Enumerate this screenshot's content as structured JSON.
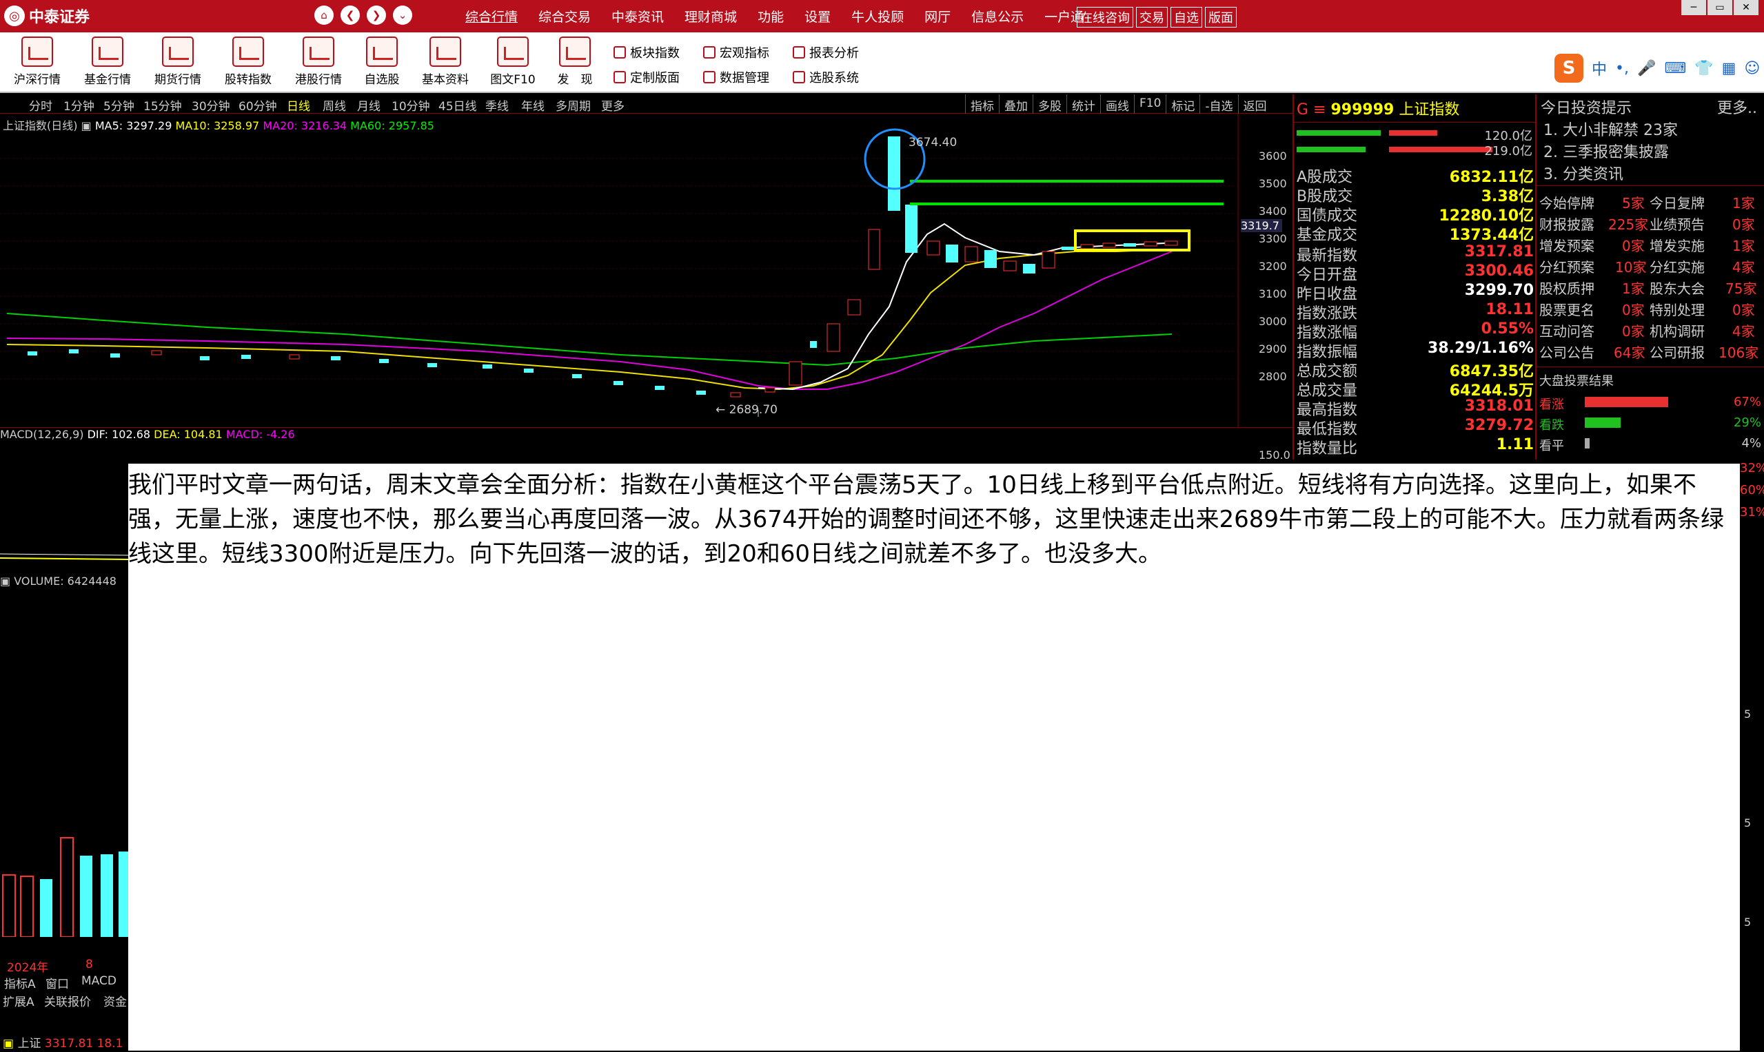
{
  "app": {
    "brand": "中泰证券",
    "top_menu": [
      "综合行情",
      "综合交易",
      "中泰资讯",
      "理财商城",
      "功能",
      "设置",
      "牛人投顾",
      "网厅",
      "信息公示",
      "一户通"
    ],
    "quick_buttons": [
      "在线咨询",
      "交易",
      "自选",
      "版面"
    ]
  },
  "toolbar": {
    "big_buttons": [
      "沪深行情",
      "基金行情",
      "期货行情",
      "股转指数",
      "港股行情",
      "自选股",
      "基本资料",
      "图文F10",
      "发　现"
    ],
    "small_buttons": [
      "板块指数",
      "宏观指标",
      "报表分析",
      "定制版面",
      "数据管理",
      "选股系统"
    ],
    "ime": [
      "中",
      "•,"
    ]
  },
  "period_bar": {
    "items": [
      "分时",
      "1分钟",
      "5分钟",
      "15分钟",
      "30分钟",
      "60分钟",
      "日线",
      "周线",
      "月线",
      "10分钟",
      "45日线",
      "季线",
      "年线",
      "多周期",
      "更多"
    ],
    "selected": "日线",
    "tools": [
      "指标",
      "叠加",
      "多股",
      "统计",
      "画线",
      "F10",
      "标记",
      "-自选",
      "返回"
    ]
  },
  "chart_header": {
    "title": "上证指数(日线)",
    "ma5": "MA5: 3297.29",
    "ma10": "MA10: 3258.97",
    "ma20": "MA20: 3216.34",
    "ma60": "MA60: 2957.85",
    "high_label": "3674.40",
    "low_label": "2689.70",
    "last_price_tag": "3319.7",
    "y_ticks": [
      "3600",
      "3500",
      "3400",
      "3300",
      "3200",
      "3100",
      "3000",
      "2900",
      "2800"
    ],
    "macd": "MACD(12,26,9)",
    "dif": "DIF: 102.68",
    "dea": "DEA: 104.81",
    "macd_val": "MACD: -4.26",
    "macd_tick": "150.0",
    "volume": "VOLUME: 6424448",
    "x_labels": [
      "2024年",
      "8"
    ],
    "colors": {
      "up": "#ff3232",
      "down": "#54ffff",
      "ma5": "#ffffff",
      "ma10": "#ffff00",
      "ma20": "#ff00ff",
      "ma60": "#00e000",
      "highlight_circle": "#1e90ff",
      "highlight_box": "#ffff00"
    }
  },
  "quote_panel": {
    "code": "999999",
    "name": "上证指数",
    "prefix": "G ≡",
    "bar_values": [
      "120.0亿",
      "219.0亿"
    ],
    "rows": [
      {
        "k": "A股成交",
        "v": "6832.11亿"
      },
      {
        "k": "B股成交",
        "v": "3.38亿"
      },
      {
        "k": "国债成交",
        "v": "12280.10亿"
      },
      {
        "k": "基金成交",
        "v": "1373.44亿"
      },
      {
        "k": "最新指数",
        "v": "3317.81"
      },
      {
        "k": "今日开盘",
        "v": "3300.46"
      },
      {
        "k": "昨日收盘",
        "v": "3299.70"
      },
      {
        "k": "指数涨跌",
        "v": "18.11"
      },
      {
        "k": "指数涨幅",
        "v": "0.55%"
      },
      {
        "k": "指数振幅",
        "v": "38.29/1.16%"
      },
      {
        "k": "总成交额",
        "v": "6847.35亿"
      },
      {
        "k": "总成交量",
        "v": "64244.5万"
      },
      {
        "k": "最高指数",
        "v": "3318.01"
      },
      {
        "k": "最低指数",
        "v": "3279.72"
      },
      {
        "k": "指数量比",
        "v": "1.11"
      }
    ]
  },
  "tips_panel": {
    "title": "今日投资提示",
    "more": "更多..",
    "news": [
      "1. 大小非解禁 23家",
      "2. 三季报密集披露",
      "3. 分类资讯"
    ],
    "stats": [
      [
        "今始停牌",
        "5家",
        "今日复牌",
        "1家"
      ],
      [
        "财报披露",
        "225家",
        "业绩预告",
        "0家"
      ],
      [
        "增发预案",
        "0家",
        "增发实施",
        "1家"
      ],
      [
        "分红预案",
        "10家",
        "分红实施",
        "4家"
      ],
      [
        "股权质押",
        "1家",
        "股东大会",
        "75家"
      ],
      [
        "股票更名",
        "0家",
        "特别处理",
        "0家"
      ],
      [
        "互动问答",
        "0家",
        "机构调研",
        "4家"
      ],
      [
        "公司公告",
        "64家",
        "公司研报",
        "106家"
      ]
    ],
    "vote_title": "大盘投票结果",
    "votes": [
      {
        "label": "看涨",
        "pct": "67%",
        "frac": 0.67,
        "color": "#e83030"
      },
      {
        "label": "看跌",
        "pct": "29%",
        "frac": 0.29,
        "color": "#20c020"
      },
      {
        "label": "看平",
        "pct": "4%",
        "frac": 0.04,
        "color": "#aaaaaa"
      }
    ],
    "right_edge": [
      "32%",
      "60%",
      "31%"
    ]
  },
  "overlay_text": "我们平时文章一两句话，周末文章会全面分析：指数在小黄框这个平台震荡5天了。10日线上移到平台低点附近。短线将有方向选择。这里向上，如果不强，无量上涨，速度也不快，那么要当心再度回落一波。从3674开始的调整时间还不够，这里快速走出来2689牛市第二段上的可能不大。压力就看两条绿线这里。短线3300附近是压力。向下先回落一波的话，到20和60日线之间就差不多了。也没多大。",
  "bottom_tabs": {
    "row1": [
      "指标A",
      "窗口",
      "MACD"
    ],
    "row2": [
      "扩展A",
      "关联报价",
      "资金"
    ]
  },
  "status": {
    "name": "上证",
    "price": "3317.81",
    "chg": "18.1"
  },
  "side_cut": [
    "5",
    "5",
    "5"
  ]
}
